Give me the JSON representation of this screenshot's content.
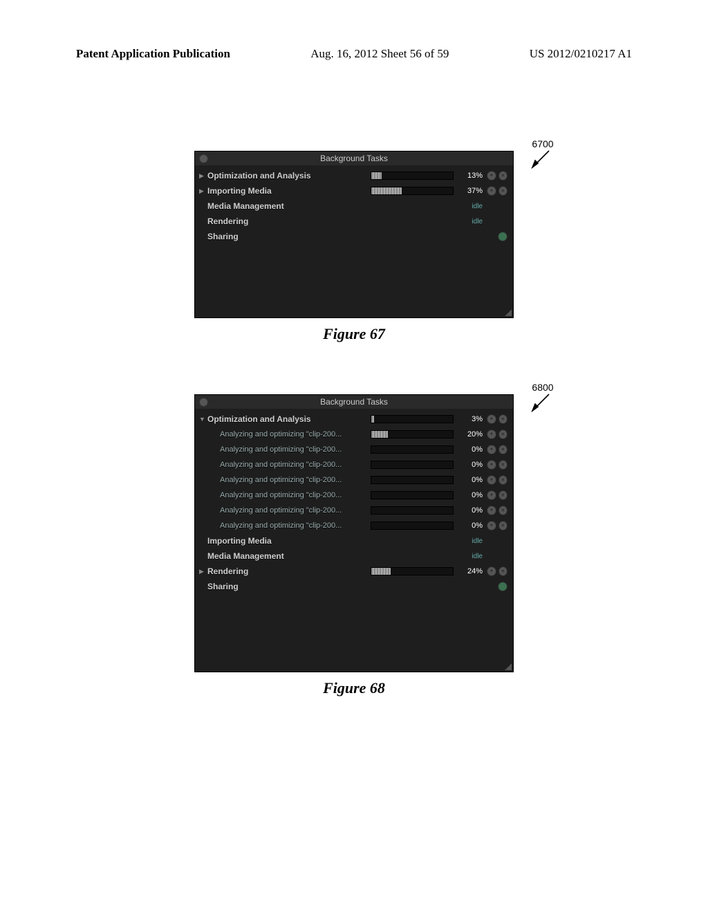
{
  "header": {
    "left": "Patent Application Publication",
    "mid": "Aug. 16, 2012  Sheet 56 of 59",
    "right": "US 2012/0210217 A1"
  },
  "fig67": {
    "caption": "Figure 67",
    "callout": "6700",
    "title": "Background Tasks",
    "rows": [
      {
        "arrow": "right",
        "kind": "group",
        "label": "Optimization and Analysis",
        "progress": 13,
        "percent": "13%",
        "controls": "pc"
      },
      {
        "arrow": "right",
        "kind": "group",
        "label": "Importing Media",
        "progress": 37,
        "percent": "37%",
        "controls": "pc"
      },
      {
        "arrow": "none",
        "kind": "group",
        "label": "Media Management",
        "status": "idle"
      },
      {
        "arrow": "none",
        "kind": "group",
        "label": "Rendering",
        "status": "idle"
      },
      {
        "arrow": "none",
        "kind": "group",
        "label": "Sharing",
        "controls": "g"
      }
    ]
  },
  "fig68": {
    "caption": "Figure 68",
    "callout": "6800",
    "title": "Background Tasks",
    "rows": [
      {
        "arrow": "down",
        "kind": "group",
        "label": "Optimization and Analysis",
        "progress": 3,
        "percent": "3%",
        "controls": "pc"
      },
      {
        "arrow": "none",
        "kind": "child",
        "label": "Analyzing and optimizing \"clip-200...",
        "progress": 20,
        "percent": "20%",
        "controls": "pc"
      },
      {
        "arrow": "none",
        "kind": "child",
        "label": "Analyzing and optimizing \"clip-200...",
        "progress": 0,
        "percent": "0%",
        "controls": "pc"
      },
      {
        "arrow": "none",
        "kind": "child",
        "label": "Analyzing and optimizing \"clip-200...",
        "progress": 0,
        "percent": "0%",
        "controls": "pc"
      },
      {
        "arrow": "none",
        "kind": "child",
        "label": "Analyzing and optimizing \"clip-200...",
        "progress": 0,
        "percent": "0%",
        "controls": "pc"
      },
      {
        "arrow": "none",
        "kind": "child",
        "label": "Analyzing and optimizing \"clip-200...",
        "progress": 0,
        "percent": "0%",
        "controls": "pc"
      },
      {
        "arrow": "none",
        "kind": "child",
        "label": "Analyzing and optimizing \"clip-200...",
        "progress": 0,
        "percent": "0%",
        "controls": "pc"
      },
      {
        "arrow": "none",
        "kind": "child",
        "label": "Analyzing and optimizing \"clip-200...",
        "progress": 0,
        "percent": "0%",
        "controls": "pc"
      },
      {
        "arrow": "none",
        "kind": "group",
        "label": "Importing Media",
        "status": "idle"
      },
      {
        "arrow": "none",
        "kind": "group",
        "label": "Media Management",
        "status": "idle"
      },
      {
        "arrow": "right",
        "kind": "group",
        "label": "Rendering",
        "progress": 24,
        "percent": "24%",
        "controls": "pc"
      },
      {
        "arrow": "none",
        "kind": "group",
        "label": "Sharing",
        "controls": "g"
      }
    ]
  }
}
